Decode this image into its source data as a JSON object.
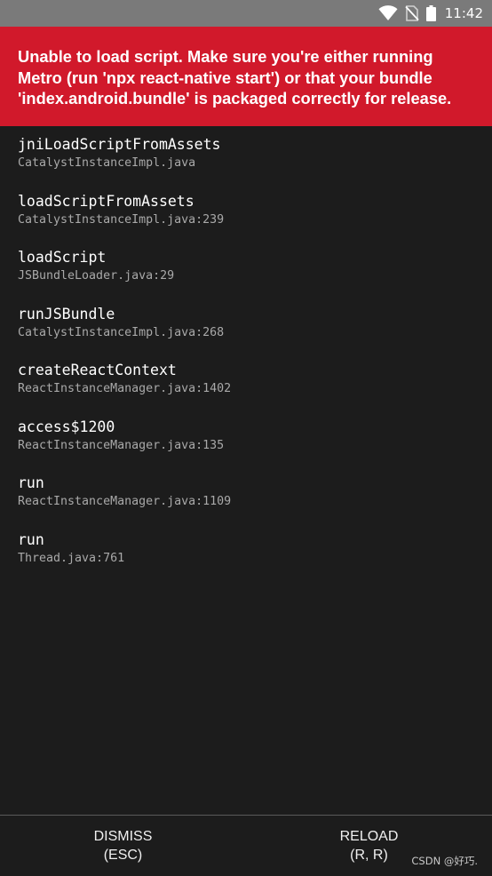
{
  "status_bar": {
    "time": "11:42",
    "icons": [
      "wifi-icon",
      "no-sim-icon",
      "battery-icon"
    ]
  },
  "error": {
    "message": "Unable to load script. Make sure you're either running Metro (run 'npx react-native start') or that your bundle 'index.android.bundle' is packaged correctly for release."
  },
  "stack": [
    {
      "method": "jniLoadScriptFromAssets",
      "file": "CatalystInstanceImpl.java"
    },
    {
      "method": "loadScriptFromAssets",
      "file": "CatalystInstanceImpl.java:239"
    },
    {
      "method": "loadScript",
      "file": "JSBundleLoader.java:29"
    },
    {
      "method": "runJSBundle",
      "file": "CatalystInstanceImpl.java:268"
    },
    {
      "method": "createReactContext",
      "file": "ReactInstanceManager.java:1402"
    },
    {
      "method": "access$1200",
      "file": "ReactInstanceManager.java:135"
    },
    {
      "method": "run",
      "file": "ReactInstanceManager.java:1109"
    },
    {
      "method": "run",
      "file": "Thread.java:761"
    }
  ],
  "footer": {
    "dismiss_line1": "DISMISS",
    "dismiss_line2": "(ESC)",
    "reload_line1": "RELOAD",
    "reload_line2": "(R, R)"
  },
  "watermark": "CSDN @好巧.",
  "colors": {
    "error_banner": "#d1192b",
    "background": "#1c1c1c",
    "status_bar": "#7a7a7a"
  }
}
